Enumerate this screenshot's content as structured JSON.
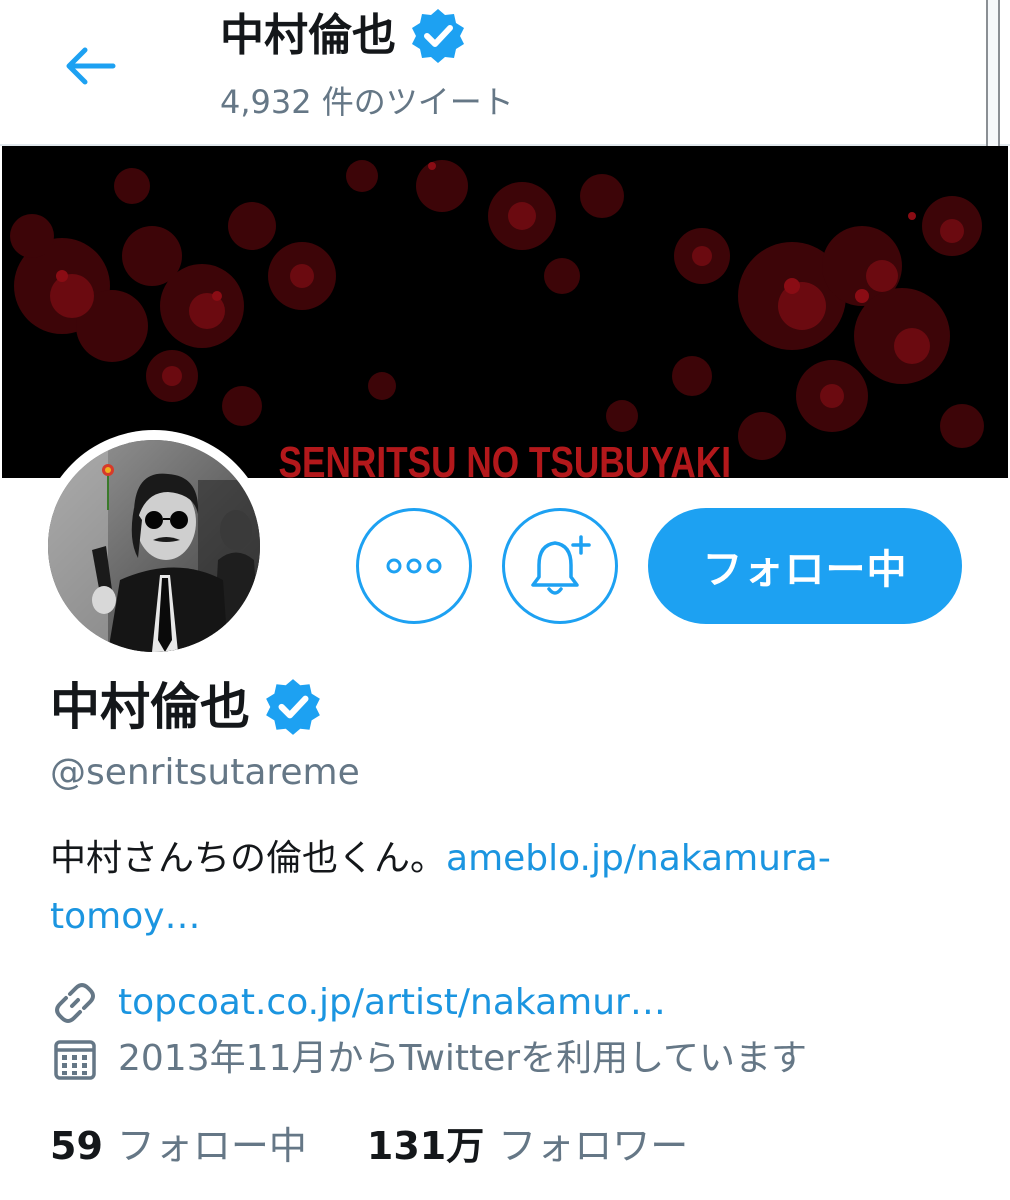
{
  "header": {
    "back_icon": "arrow-left-icon",
    "name": "中村倫也",
    "verified_icon": "verified-badge-icon",
    "tweet_count": "4,932 件のツイート"
  },
  "banner": {
    "text": "SENRITSU NO TSUBUYAKI",
    "text_color": "#b3181b",
    "background": "#000000"
  },
  "actions": {
    "more_icon": "more-dots-icon",
    "notify_icon": "bell-plus-icon",
    "follow_label": "フォロー中"
  },
  "profile": {
    "name": "中村倫也",
    "handle": "@senritsutareme",
    "bio_text": "中村さんちの倫也くん。",
    "bio_link_line1": "ameblo.jp/nakamura-",
    "bio_link_line2": "tomoy…",
    "website": "topcoat.co.jp/artist/nakamur…",
    "website_icon": "link-icon",
    "joined": "2013年11月からTwitterを利用しています",
    "joined_icon": "calendar-icon"
  },
  "stats": {
    "following_count": "59",
    "following_label": "フォロー中",
    "followers_count": "131万",
    "followers_label": "フォロワー"
  },
  "colors": {
    "accent": "#1da1f2",
    "link": "#1b95e0",
    "secondary_text": "#657786"
  }
}
